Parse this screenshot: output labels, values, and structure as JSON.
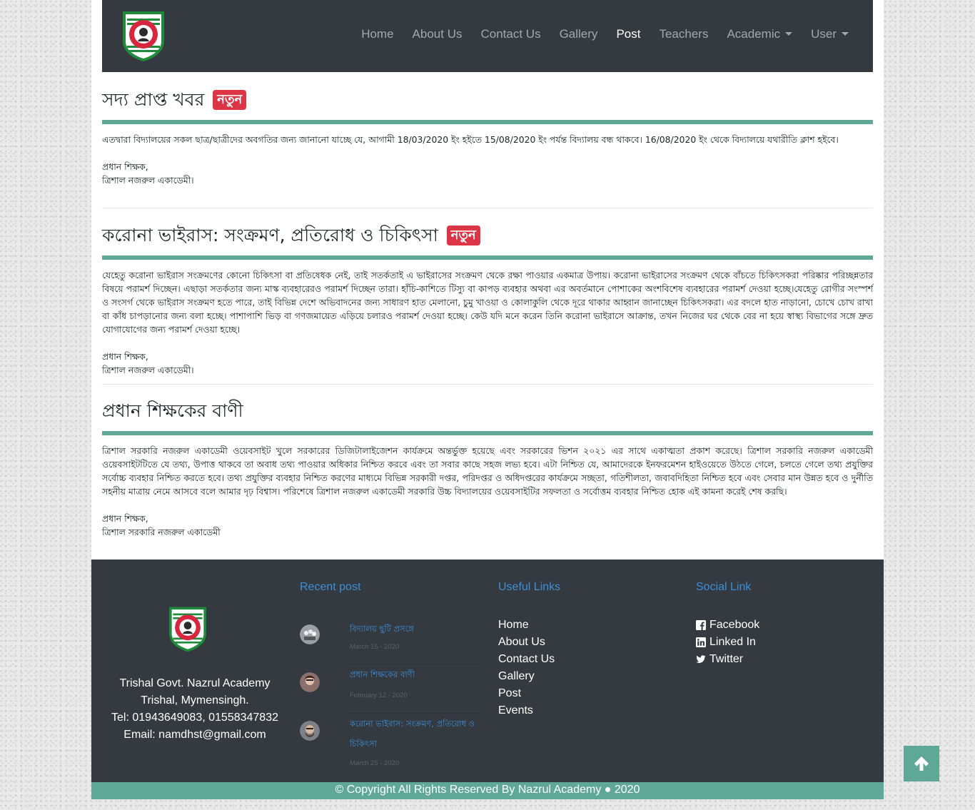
{
  "nav": {
    "items": [
      {
        "label": "Home",
        "active": false,
        "dropdown": false
      },
      {
        "label": "About Us",
        "active": false,
        "dropdown": false
      },
      {
        "label": "Contact Us",
        "active": false,
        "dropdown": false
      },
      {
        "label": "Gallery",
        "active": false,
        "dropdown": false
      },
      {
        "label": "Post",
        "active": true,
        "dropdown": false
      },
      {
        "label": "Teachers",
        "active": false,
        "dropdown": false
      },
      {
        "label": "Academic",
        "active": false,
        "dropdown": true
      },
      {
        "label": "User",
        "active": false,
        "dropdown": true
      }
    ]
  },
  "posts": [
    {
      "title": "সদ্য প্রাপ্ত খবর",
      "badge": "নতুন",
      "body": "এতদ্বারা বিদ্যালয়ের সকল ছাত্র/ছাত্রীদের অবগতির জন্য জানানো যাচ্ছে যে, আগামী 18/03/2020 ইং হইতে 15/08/2020 ইং পর্যন্ত বিদ্যালয় বন্ধ থাকবে। 16/08/2020 ইং থেকে বিদ্যালয়ে যথারীতি ক্লাশ হইবে।",
      "sig_line1": "প্রধান শিক্ষক,",
      "sig_line2": "ত্রিশাল নজরুল একাডেমী।"
    },
    {
      "title": "করোনা ভাইরাস: সংক্রমণ, প্রতিরোধ ও চিকিৎসা",
      "badge": "নতুন",
      "body": "যেহেতু করোনা ভাইরাস সংক্রমণের কোনো চিকিৎসা বা প্রতিষেধক নেই, তাই সতর্কতাই এ ভাইরাসের সংক্রমণ থেকে রক্ষা পাওয়ার একমাত্র উপায়। করোনা ভাইরাসের সংক্রমণ থেকে বাঁচতে চিকিৎসকরা পরিষ্কার পরিচ্ছন্নতার বিষয়ে পরামর্শ দিচ্ছেন। এছাড়া সতর্কতার জন্য মাস্ক ব্যবহারেরও পরামর্শ দিচ্ছেন তারা। হাঁচি-কাশিতে টিস্যু বা কাপড় ব্যবহার অথবা এর অবর্তমানে পোশাকের অংশবিশেষ ব্যবহারের পরামর্শ দেওয়া হচ্ছে।যেহেতু রোগীর সংস্পর্শ ও সংসর্গ থেকে ভাইরাস সংক্রমণ হতে পারে, তাই বিভিন্ন দেশে অভিবাদনের জন্য সাধারণ হাত মেলানো, চুমু খাওয়া ও কোলাকুলি থেকে দূরে থাকার আহ্বান জানাচ্ছেন চিকিৎসকরা। এর বদলে হাত নাড়ানো, চোখে চোখ রাখা বা কাঁধ চাপড়ানোর জন্য বলা হচ্ছে। পাশাপাশি ভিড় বা গণজমায়েত এড়িয়ে চলারও পরামর্শ দেওয়া হচ্ছে। কেউ যদি মনে করেন তিনি করোনা ভাইরাসে আক্রান্ত, তখন নিজের ঘর থেকে বের না হয়ে স্বাস্থ্য বিভাগের সঙ্গে দ্রুত যোগাযোগের জন্য পরামর্শ দেওয়া হচ্ছে।",
      "sig_line1": "প্রধান শিক্ষক,",
      "sig_line2": "ত্রিশাল নজরুল একাডেমী।"
    },
    {
      "title": "প্রধান শিক্ষকের বাণী",
      "badge": "",
      "body": "ত্রিশাল সরকারি নজরুল একাডেমী ওয়েবসাইট খুলে সরকারের ডিজিটালাইজেশন কার্যক্রমে অন্তর্ভুক্ত হয়েছে এবং সরকারের ভিশন ২০২১ এর সাথে একাত্মতা প্রকাশ করেছে। ত্রিশাল সরকারি নজরুল একাডেমী ওয়েবসাইটটিতে যে তথ্য, উপাত্ত থাকবে তা অবাধ তথ্য পাওয়ার অধিকার নিশ্চিত করবে এবং তা সবার কাছে সহজ লভ্য হবে। এটা নিশ্চিত যে, আমাদেরকে ইনফরমেশন হাইওয়েতে উঠতে গেলে, চলতে গেলে তথ্য প্রযুক্তির সর্বোচ্চ ব্যবহার নিশ্চিত করতে হবে। তথ্য প্রযুক্তির ব্যবহার নিশ্চিত করণের মাধ্যমে বিভিন্ন সরকারী দপ্তর, পরিদপ্তর ও অধিদপ্তরের কার্যক্রমে সচ্ছতা, গতিশীলতা, জবাবদিহিতা নিশ্চিত হবে এবং সেবার মান উন্নত হবে ও দুর্নীতি সহনীয় মাত্রায় নেমে আসবে বলে আমার দৃঢ় বিশ্বাস। পরিশেষে ত্রিশাল নজরুল একাডেমী সরকারি উচ্চ বিদ্যালয়ের ওয়েবসাইটির সফলতা ও সর্বোত্তম ব্যবহার নিশ্চিত হোক এই কামনা করেই শেষ করছি।",
      "sig_line1": "প্রধান শিক্ষক,",
      "sig_line2": "ত্রিশাল সরকারি নজরুল একাডেমী"
    }
  ],
  "footer": {
    "info": {
      "name": "Trishal Govt. Nazrul Academy",
      "address": "Trishal, Mymensingh.",
      "tel": "Tel: 01943649083, 01558347832",
      "email": "Email: namdhst@gmail.com"
    },
    "recent_title": "Recent post",
    "recent": [
      {
        "title": "বিদ্যালয় ছুটি প্রসঙ্গে",
        "date": "March 15 - 2020"
      },
      {
        "title": "প্রধান শিক্ষকের বাণী",
        "date": "February 12 - 2020"
      },
      {
        "title": "করোনা ভাইরাস: সংক্রমণ, প্রতিরোধ ও চিকিৎসা",
        "date": "March 25 - 2020"
      }
    ],
    "links_title": "Useful Links",
    "links": [
      "Home",
      "About Us",
      "Contact Us",
      "Gallery",
      "Post",
      "Events"
    ],
    "social_title": "Social Link",
    "social": [
      {
        "label": "Facebook",
        "icon": "facebook-icon"
      },
      {
        "label": "Linked In",
        "icon": "linkedin-icon"
      },
      {
        "label": "Twitter",
        "icon": "twitter-icon"
      }
    ],
    "copyright": "© Copyright All Rights Reserved By Nazrul Academy ● 2020"
  },
  "colors": {
    "navbar": "#343a40",
    "accent": "#5fa897",
    "badge": "#dc3545",
    "link": "#3b8fd8"
  },
  "back_to_top_icon": "arrow-up-icon"
}
